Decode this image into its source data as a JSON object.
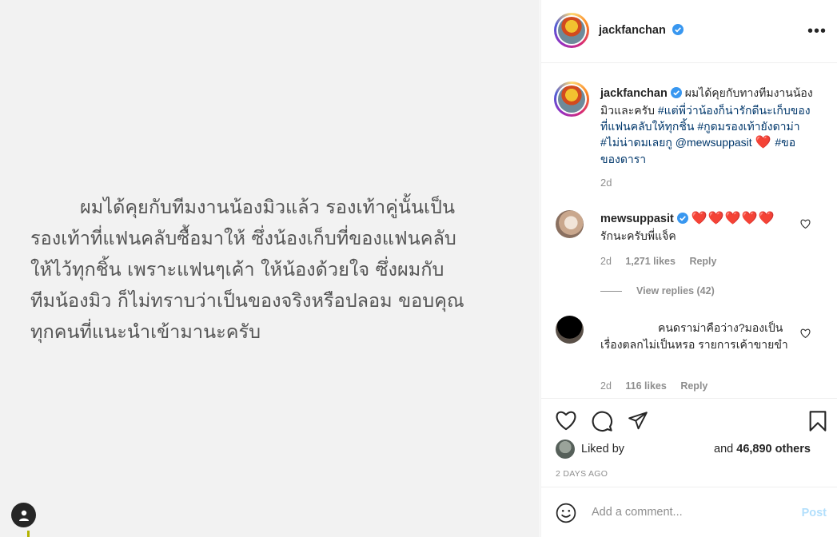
{
  "post": {
    "text_lines": [
      "ผมได้คุยกับทีมงานน้องมิวแล้ว รองเท้าคู่นั้นเป็น",
      "รองเท้าที่แฟนคลับซื้อมาให้ ซึ่งน้องเก็บที่ของแฟนคลับ",
      "ให้ไว้ทุกชิ้น เพราะแฟนๆเค้า ให้น้องด้วยใจ ซึ่งผมกับ",
      "ทีมน้องมิว ก็ไม่ทราบว่าเป็นของจริงหรือปลอม ขอบคุณ",
      "ทุกคนที่แนะนำเข้ามานะครับ"
    ]
  },
  "header": {
    "username": "jackfanchan",
    "more_label": "•••"
  },
  "caption": {
    "username": "jackfanchan",
    "text_a": "ผมได้คุยกับทางทีมงานน้องมิวและครับ",
    "tag1": "#แต่พี่ว่าน้องก็น่ารักดีนะเก็บของที่แฟนคลับให้ทุกชิ้น",
    "tag2": "#กูดมรองเท้ายังดาม่า",
    "tag3": "#ไม่น่าดมเลยกู",
    "mention": "@mewsuppasit",
    "heart": "❤️",
    "tag4": "#ขอของดารา",
    "time": "2d"
  },
  "comments": [
    {
      "username": "mewsuppasit",
      "hearts": "❤️❤️❤️❤️❤️",
      "text": "รักนะครับพี่แจ็ค",
      "time": "2d",
      "likes": "1,271 likes",
      "reply": "Reply",
      "view_replies": "View replies (42)"
    },
    {
      "username": "",
      "text": "คนดราม่าคือว่าง?มองเป็นเรื่องตลกไม่เป็นหรอ รายการเค้าขายขำ",
      "time": "2d",
      "likes": "116 likes",
      "reply": "Reply"
    }
  ],
  "likes": {
    "liked_by": "Liked by",
    "and": "and",
    "others": "46,890 others",
    "date": "2 DAYS AGO"
  },
  "add_comment": {
    "placeholder": "Add a comment...",
    "post_label": "Post"
  },
  "icons": {
    "more": "more-options-icon",
    "like": "heart-icon",
    "comment": "comment-icon",
    "share": "share-icon",
    "save": "bookmark-icon",
    "emoji": "emoji-icon",
    "verified": "verified-badge-icon",
    "tag_user": "tagged-user-icon"
  },
  "colors": {
    "link": "#00376b",
    "muted": "#8e8e8e",
    "verified": "#3897f0",
    "heart": "#ed4956",
    "post_disabled": "#b2dffc"
  }
}
